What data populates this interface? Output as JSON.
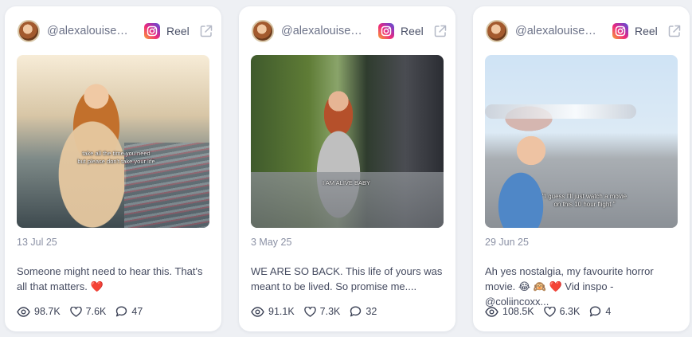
{
  "posts": [
    {
      "handle": "@alexalouisewill...",
      "type_label": "Reel",
      "media_caption": "take all the time you need\nbut please don't take your life",
      "date": "13 Jul 25",
      "text": "Someone might need to hear this. That's all that matters.",
      "emoji": "❤️",
      "views": "98.7K",
      "likes": "7.6K",
      "comments": "47"
    },
    {
      "handle": "@alexalouisewill...",
      "type_label": "Reel",
      "media_caption": "I AM ALIVE BABY",
      "date": "3 May 25",
      "text": "WE ARE SO BACK. This life of yours was meant to be lived. So promise me....",
      "emoji": "",
      "views": "91.1K",
      "likes": "7.3K",
      "comments": "32"
    },
    {
      "handle": "@alexalouisewill...",
      "type_label": "Reel",
      "media_caption": "\"I guess I'll just watch a movie\non this 10 hour flight.\"",
      "date": "29 Jun 25",
      "text": "Ah yes nostalgia, my favourite horror movie. 😂 🙉 ❤️ Vid inspo - @coliincoxx...",
      "emoji": "",
      "views": "108.5K",
      "likes": "6.3K",
      "comments": "4"
    }
  ],
  "icons": {
    "platform": "instagram-icon",
    "external": "external-link-icon",
    "views": "eye-icon",
    "likes": "heart-icon",
    "comments": "comment-icon"
  },
  "colors": {
    "background": "#eef0f4",
    "card": "#ffffff",
    "muted": "#8a90a4",
    "text": "#454b60",
    "heart": "#e8407c"
  }
}
